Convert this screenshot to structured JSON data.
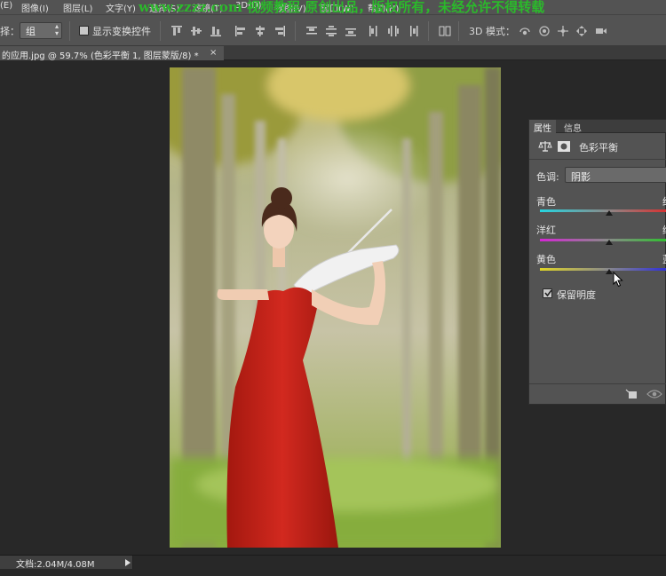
{
  "menubar": {
    "items": [
      "(E)",
      "图像(I)",
      "图层(L)",
      "文字(Y)",
      "选择(S)",
      "滤镜(T)",
      "3D(D)",
      "视图(V)",
      "窗口(W)",
      "帮助(H)"
    ],
    "watermark": "www.zzzz.com 视频教程 原创出品，版权所有，未经允许不得转载"
  },
  "options": {
    "select_prefix": "择：",
    "select_value": "组",
    "show_transform_label": "显示变换控件",
    "mode_3d_label": "3D 模式："
  },
  "document": {
    "tab_title": "的应用.jpg @ 59.7% (色彩平衡 1, 图层蒙版/8) *",
    "close_glyph": "×"
  },
  "properties": {
    "tabs": [
      "属性",
      "信息"
    ],
    "title": "色彩平衡",
    "tone_label": "色调:",
    "tone_value": "阴影",
    "sliders": [
      {
        "left": "青色",
        "right": "红色",
        "value": 0
      },
      {
        "left": "洋红",
        "right": "绿色",
        "value": 0
      },
      {
        "left": "黄色",
        "right": "蓝色",
        "value": 0
      }
    ],
    "preserve_label": "保留明度",
    "preserve_checked": true
  },
  "status": {
    "doc_info": "文档:2.04M/4.08M"
  },
  "colors": {
    "ui_bg": "#535353",
    "workspace": "#282828",
    "watermark": "#2bb92b",
    "dress": "#c4231c"
  }
}
